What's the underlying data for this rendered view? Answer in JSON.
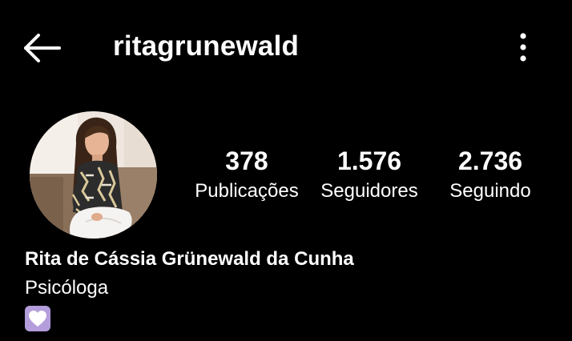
{
  "header": {
    "username": "ritagrunewald",
    "back_icon": "arrow-left-icon",
    "more_icon": "more-vertical-icon"
  },
  "profile": {
    "avatar_icon": "profile-photo",
    "stats": {
      "posts": {
        "value": "378",
        "label": "Publicações"
      },
      "followers": {
        "value": "1.576",
        "label": "Seguidores"
      },
      "following": {
        "value": "2.736",
        "label": "Seguindo"
      }
    },
    "full_name": "Rita de Cássia Grünewald da Cunha",
    "bio": "Psicóloga",
    "bio_emoji": "white-heart-emoji"
  },
  "colors": {
    "background": "#000000",
    "text": "#ffffff",
    "emoji_bg": "#b39ddb",
    "emoji_heart": "#ffffff"
  }
}
